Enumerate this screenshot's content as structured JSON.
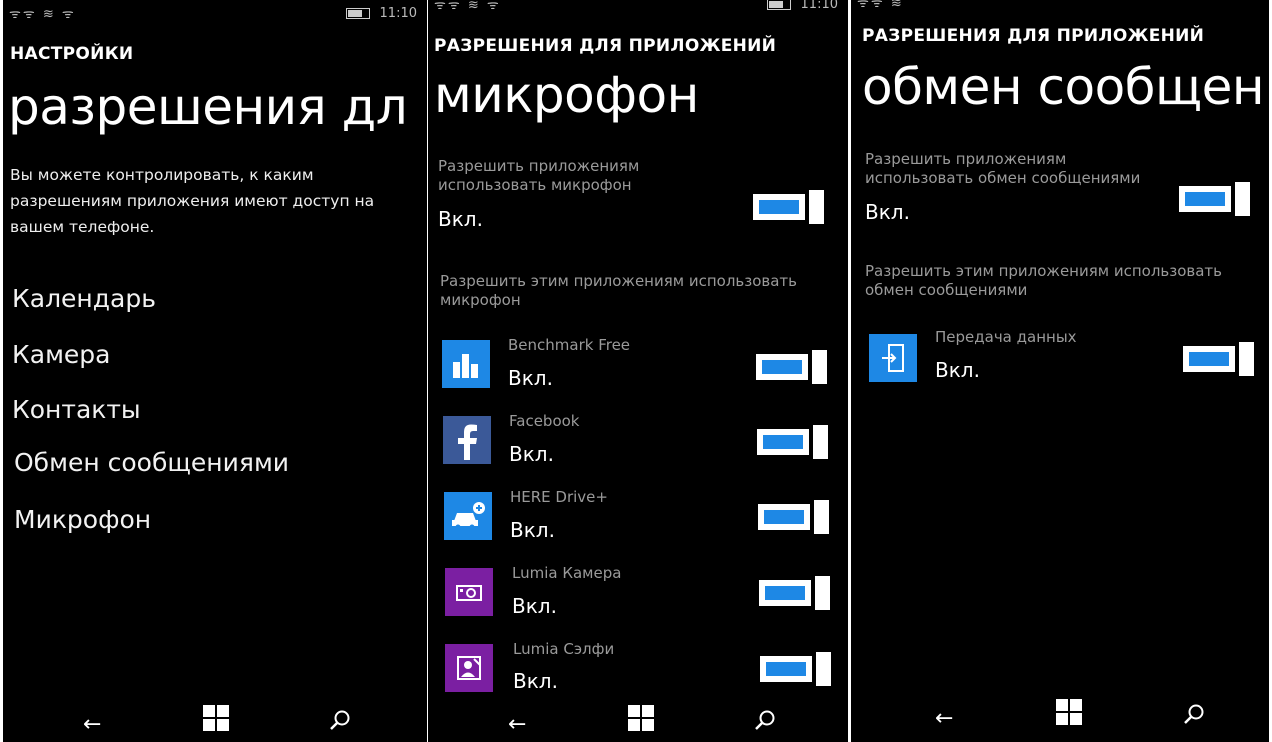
{
  "screen1": {
    "status": {
      "signal": "ᯤᯤ ≋ ᯤ",
      "time": "11:10"
    },
    "header": "НАСТРОЙКИ",
    "title": "разрешения дл",
    "description": "Вы можете контролировать, к каким разрешениям приложения имеют доступ на вашем телефоне.",
    "categories": [
      "Календарь",
      "Камера",
      "Контакты",
      "Обмен сообщениями",
      "Микрофон"
    ]
  },
  "screen2": {
    "status": {
      "signal": "ᯤᯤ ≋ ᯤ",
      "time": "11:10"
    },
    "header": "РАЗРЕШЕНИЯ ДЛЯ ПРИЛОЖЕНИЙ",
    "title": "микрофон",
    "global_label": "Разрешить приложениям использовать микрофон",
    "global_state": "Вкл.",
    "apps_label": "Разрешить этим приложениям использовать микрофон",
    "apps": [
      {
        "name": "Benchmark Free",
        "state": "Вкл.",
        "icon": "bar-chart-icon",
        "color": "#1e88e5"
      },
      {
        "name": "Facebook",
        "state": "Вкл.",
        "icon": "facebook-icon",
        "color": "#3b5998"
      },
      {
        "name": "HERE Drive+",
        "state": "Вкл.",
        "icon": "car-icon",
        "color": "#1e88e5"
      },
      {
        "name": "Lumia Камера",
        "state": "Вкл.",
        "icon": "camera-icon",
        "color": "#7b1fa2"
      },
      {
        "name": "Lumia Сэлфи",
        "state": "Вкл.",
        "icon": "selfie-icon",
        "color": "#7b1fa2"
      }
    ]
  },
  "screen3": {
    "status": {
      "signal": "ᯤᯤ ≋",
      "time": ""
    },
    "header": "РАЗРЕШЕНИЯ ДЛЯ ПРИЛОЖЕНИЙ",
    "title": "обмен сообщен",
    "global_label": "Разрешить приложениям использовать обмен сообщениями",
    "global_state": "Вкл.",
    "apps_label": "Разрешить этим приложениям использовать обмен сообщениями",
    "apps": [
      {
        "name": "Передача данных",
        "state": "Вкл.",
        "icon": "data-transfer-icon",
        "color": "#1e88e5"
      }
    ]
  },
  "nav": {
    "back": "←",
    "search": "⌕"
  },
  "colors": {
    "accent": "#1e88e5",
    "background": "#000000",
    "secondary_text": "#9a9a9a"
  }
}
